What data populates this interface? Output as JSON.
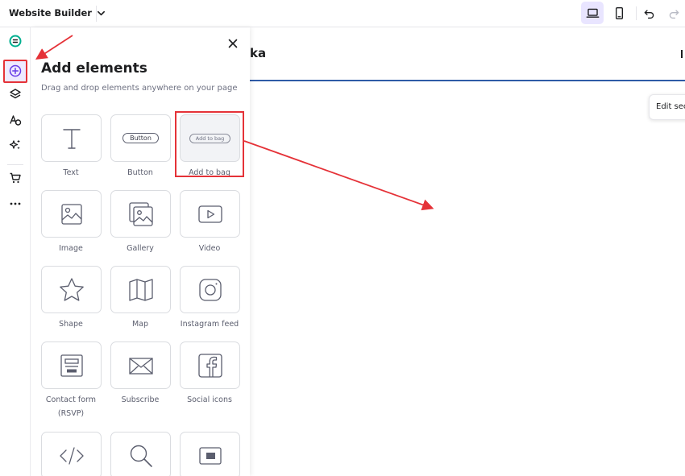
{
  "app": {
    "title": "Website Builder"
  },
  "toolbar": {
    "desktop": "laptop-icon",
    "mobile": "phone-icon",
    "undo": "undo-icon",
    "redo": "redo-icon"
  },
  "rail": {
    "items": [
      "logo-icon",
      "add-elements-icon",
      "layers-icon",
      "styles-icon",
      "ai-tools-icon",
      "store-icon",
      "more-icon"
    ]
  },
  "panel": {
    "title": "Add elements",
    "subtitle": "Drag and drop elements anywhere on your page",
    "elements": [
      {
        "label": "Text",
        "icon": "text-icon"
      },
      {
        "label": "Button",
        "icon": "button-preview",
        "preview": "Button"
      },
      {
        "label": "Add to bag",
        "icon": "add-to-bag-preview",
        "preview": "Add to bag"
      },
      {
        "label": "Image",
        "icon": "image-icon"
      },
      {
        "label": "Gallery",
        "icon": "gallery-icon"
      },
      {
        "label": "Video",
        "icon": "video-icon"
      },
      {
        "label": "Shape",
        "icon": "star-icon"
      },
      {
        "label": "Map",
        "icon": "map-icon"
      },
      {
        "label": "Instagram feed",
        "icon": "instagram-icon"
      },
      {
        "label": "Contact form",
        "label2": "(RSVP)",
        "icon": "form-icon"
      },
      {
        "label": "Subscribe",
        "icon": "envelope-icon"
      },
      {
        "label": "Social icons",
        "icon": "facebook-icon"
      },
      {
        "label": "",
        "icon": "code-icon"
      },
      {
        "label": "",
        "icon": "search-icon"
      },
      {
        "label": "",
        "icon": "embed-icon"
      }
    ]
  },
  "canvas": {
    "heading": "ka",
    "edit_tooltip": "Edit sec"
  },
  "colors": {
    "accent": "#673de6",
    "active_bg": "#e9e5ff",
    "annotation": "#e53238",
    "canvas_line": "#2f5ba7"
  }
}
